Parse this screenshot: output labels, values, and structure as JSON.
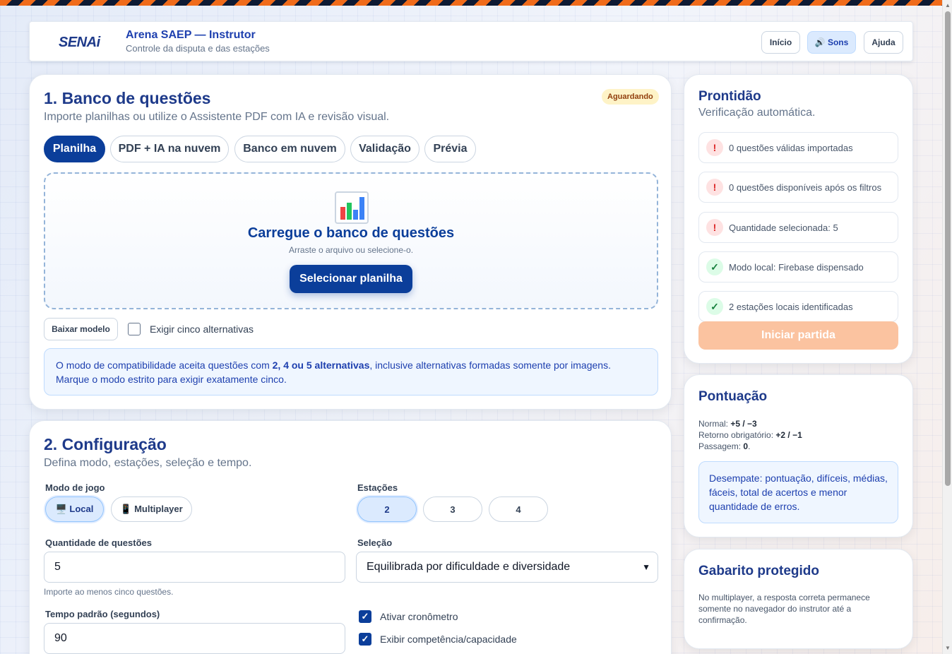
{
  "header": {
    "logo": "SENAi",
    "title": "Arena SAEP — Instrutor",
    "subtitle": "Controle da disputa e das estações",
    "buttons": {
      "home": "Início",
      "sounds": "🔊 Sons",
      "help": "Ajuda"
    }
  },
  "bank": {
    "title": "1. Banco de questões",
    "subtitle": "Importe planilhas ou utilize o Assistente PDF com IA e revisão visual.",
    "status_badge": "Aguardando",
    "tabs": [
      "Planilha",
      "PDF + IA na nuvem",
      "Banco em nuvem",
      "Validação",
      "Prévia"
    ],
    "dropzone": {
      "icon": "bar-chart-icon",
      "title": "Carregue o banco de questões",
      "subtitle": "Arraste o arquivo ou selecione-o.",
      "button": "Selecionar planilha"
    },
    "download_template": "Baixar modelo",
    "require_five_label": "Exigir cinco alternativas",
    "require_five_checked": false,
    "info": {
      "pre": "O modo de compatibilidade aceita questões com ",
      "bold": "2, 4 ou 5 alternativas",
      "post": ", inclusive alternativas formadas somente por imagens. Marque o modo estrito para exigir exatamente cinco."
    }
  },
  "readiness": {
    "title": "Prontidão",
    "subtitle": "Verificação automática.",
    "items": [
      {
        "status": "warn",
        "icon": "!",
        "text": "0 questões válidas importadas"
      },
      {
        "status": "warn",
        "icon": "!",
        "text": "0 questões disponíveis após os filtros"
      },
      {
        "status": "warn",
        "icon": "!",
        "text": "Quantidade selecionada: 5"
      },
      {
        "status": "ok",
        "icon": "✓",
        "text": "Modo local: Firebase dispensado"
      },
      {
        "status": "ok",
        "icon": "✓",
        "text": "2 estações locais identificadas"
      }
    ],
    "start_button": "Iniciar partida"
  },
  "scoring": {
    "title": "Pontuação",
    "lines": [
      {
        "label": "Normal: ",
        "value": "+5 / −3",
        "suffix": ""
      },
      {
        "label": "Retorno obrigatório: ",
        "value": "+2 / −1",
        "suffix": ""
      },
      {
        "label": "Passagem: ",
        "value": "0",
        "suffix": "."
      }
    ],
    "tiebreak": "Desempate: pontuação, difíceis, médias, fáceis, total de acertos e menor quantidade de erros."
  },
  "answers": {
    "title": "Gabarito protegido",
    "text": "No multiplayer, a resposta correta permanece somente no navegador do instrutor até a confirmação."
  },
  "config": {
    "title": "2. Configuração",
    "subtitle": "Defina modo, estações, seleção e tempo.",
    "mode_label": "Modo de jogo",
    "modes": [
      {
        "label": "🖥️ Local",
        "active": true
      },
      {
        "label": "📱 Multiplayer",
        "active": false
      }
    ],
    "stations_label": "Estações",
    "stations": [
      {
        "label": "2",
        "active": true
      },
      {
        "label": "3",
        "active": false
      },
      {
        "label": "4",
        "active": false
      }
    ],
    "quantity_label": "Quantidade de questões",
    "quantity_value": "5",
    "quantity_hint": "Importe ao menos cinco questões.",
    "selection_label": "Seleção",
    "selection_value": "Equilibrada por dificuldade e diversidade",
    "time_label": "Tempo padrão (segundos)",
    "time_value": "90",
    "timer_label": "Ativar cronômetro",
    "timer_checked": true,
    "competence_label": "Exibir competência/capacidade",
    "competence_checked": true
  },
  "colors": {
    "primary": "#0b3e9a",
    "accent": "#f06b1a",
    "warn": "#dc2626",
    "ok": "#15803d"
  }
}
